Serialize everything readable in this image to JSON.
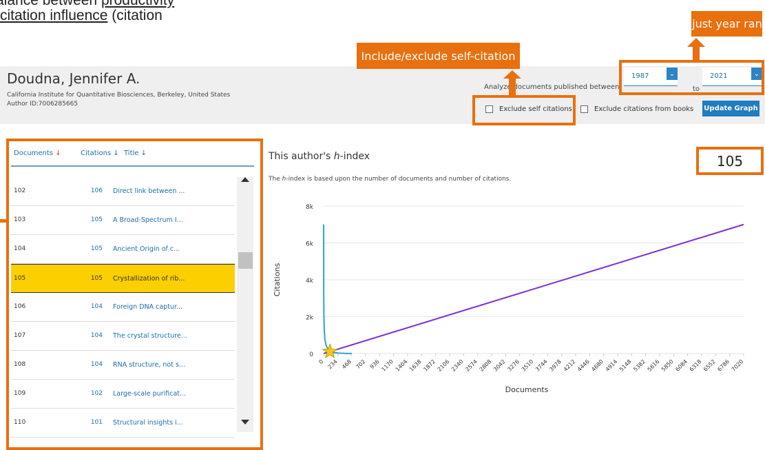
{
  "slide": {
    "line1_prefix": "alance between ",
    "line1_link": "productivity",
    "line2_link": "citation influence",
    "line2_suffix": " (citation"
  },
  "callouts": {
    "year_range": "Adjust year range",
    "self_citation": "Include/exclude self-citation"
  },
  "author": {
    "name": "Doudna, Jennifer A.",
    "affiliation": "California Institute for Quantitative Biosciences, Berkeley, United States",
    "author_id": "Author ID:7006285665"
  },
  "controls": {
    "analyze_label": "Analyze documents published between",
    "year_from": "1987",
    "to_label": "to",
    "year_to": "2021",
    "exclude_self": "Exclude self citations",
    "exclude_books": "Exclude citations from books",
    "update_button": "Update Graph"
  },
  "table": {
    "headers": {
      "documents": "Documents",
      "citations": "Citations",
      "title": "Title"
    },
    "rows": [
      {
        "doc": "102",
        "citations": "106",
        "title": "Direct link between ..."
      },
      {
        "doc": "103",
        "citations": "105",
        "title": "A Broad-Spectrum I..."
      },
      {
        "doc": "104",
        "citations": "105",
        "title": "Ancient Origin of c..."
      },
      {
        "doc": "105",
        "citations": "105",
        "title": "Crystallization of rib..."
      },
      {
        "doc": "106",
        "citations": "104",
        "title": "Foreign DNA captur..."
      },
      {
        "doc": "107",
        "citations": "104",
        "title": "The crystal structure..."
      },
      {
        "doc": "108",
        "citations": "104",
        "title": "RNA structure, not s..."
      },
      {
        "doc": "109",
        "citations": "102",
        "title": "Large-scale purificat..."
      },
      {
        "doc": "110",
        "citations": "101",
        "title": "Structural insights i..."
      }
    ],
    "highlighted_row": 3
  },
  "hindex": {
    "title_prefix": "This author's ",
    "title_h": "h",
    "title_suffix": "-index",
    "desc_prefix": "The ",
    "desc_h": "h",
    "desc_suffix": "-index is based upon the number of documents and number of citations.",
    "value": "105"
  },
  "colors": {
    "accent_orange": "#e8700f",
    "link_blue": "#1a6ea8",
    "highlight_yellow": "#fccf00",
    "line_purple": "#7b2fd6",
    "citation_blue": "#29a3d6"
  },
  "chart_data": {
    "type": "line",
    "xlabel": "Documents",
    "ylabel": "Citations",
    "ylim": [
      0,
      8000
    ],
    "xlim": [
      0,
      7020
    ],
    "y_ticks": [
      "0",
      "2k",
      "4k",
      "6k",
      "8k"
    ],
    "y_tick_values": [
      0,
      2000,
      4000,
      6000,
      8000
    ],
    "x_ticks": [
      "0",
      "234",
      "468",
      "702",
      "936",
      "1170",
      "1404",
      "1638",
      "1872",
      "2106",
      "2340",
      "2574",
      "2808",
      "3042",
      "3276",
      "3510",
      "3744",
      "3978",
      "4212",
      "4446",
      "4680",
      "4914",
      "5148",
      "5382",
      "5616",
      "5850",
      "6084",
      "6318",
      "6552",
      "6786",
      "7020"
    ],
    "series": [
      {
        "x": [
          0,
          7020
        ],
        "y": [
          0,
          7000
        ]
      },
      {
        "x": [
          0,
          2,
          5,
          10,
          20,
          40,
          80,
          105,
          150,
          250,
          350,
          470
        ],
        "y": [
          7000,
          3200,
          2100,
          1300,
          800,
          450,
          200,
          105,
          60,
          25,
          8,
          1
        ]
      }
    ],
    "marker": {
      "x": 105,
      "y": 105
    }
  }
}
